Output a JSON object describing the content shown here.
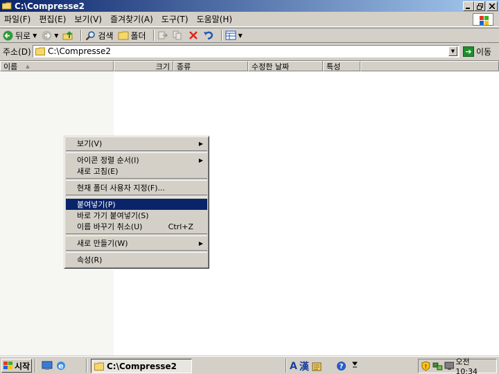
{
  "window": {
    "title": "C:\\Compresse2"
  },
  "menubar": {
    "items": [
      "파일(F)",
      "편집(E)",
      "보기(V)",
      "즐겨찾기(A)",
      "도구(T)",
      "도움말(H)"
    ]
  },
  "toolbar": {
    "back_label": "뒤로",
    "search_label": "검색",
    "folders_label": "폴더"
  },
  "address": {
    "label": "주소(D)",
    "value": "C:\\Compresse2",
    "go_label": "이동"
  },
  "columns": {
    "name": "이름",
    "size": "크기",
    "type": "종류",
    "modified": "수정한 날짜",
    "attributes": "특성"
  },
  "context_menu": {
    "view": "보기(V)",
    "arrange_icons": "아이콘 정렬 순서(I)",
    "refresh": "새로 고침(E)",
    "customize_folder": "현재 폴더 사용자 지정(F)...",
    "paste": "붙여넣기(P)",
    "paste_shortcut": "바로 가기 붙여넣기(S)",
    "undo_rename": "이름 바꾸기 취소(U)",
    "undo_shortcut": "Ctrl+Z",
    "new": "새로 만들기(W)",
    "properties": "속성(R)"
  },
  "taskbar": {
    "start_label": "시작",
    "task_label": "C:\\Compresse2",
    "lang_a": "A",
    "lang_han": "漢",
    "clock": "오전 10:34"
  }
}
